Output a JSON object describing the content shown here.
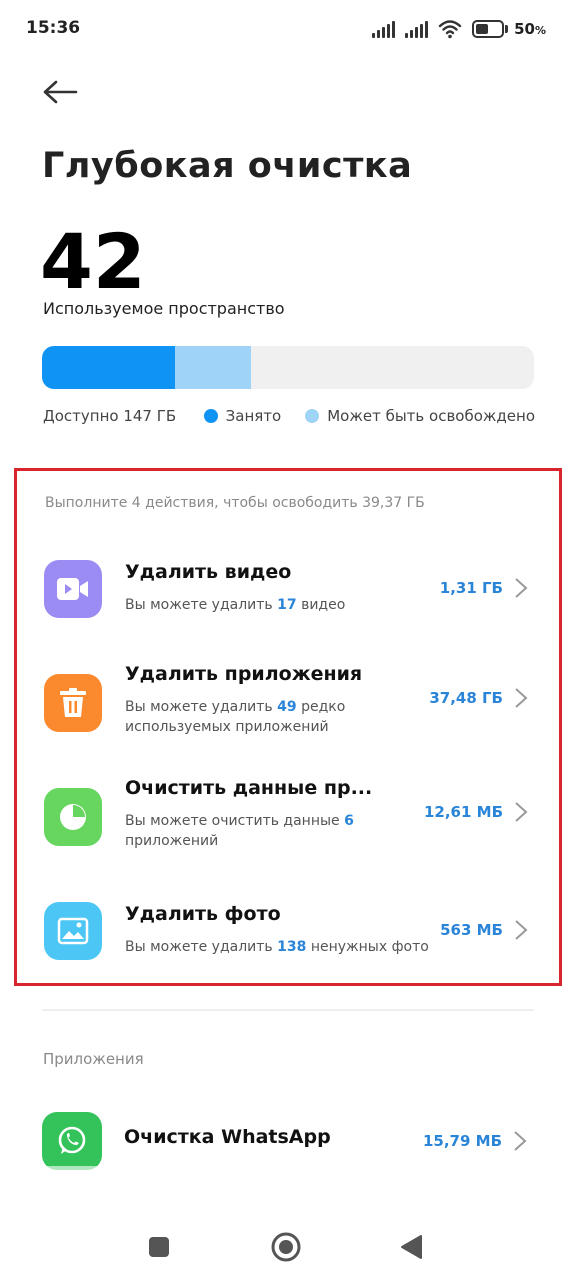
{
  "status_bar": {
    "time": "15:36",
    "battery_percent": "50",
    "battery_suffix": "%",
    "icons": [
      "signal-icon",
      "signal-icon",
      "wifi-icon",
      "battery-icon"
    ]
  },
  "header": {
    "back_icon": "arrow-left-icon",
    "title": "Глубокая очистка"
  },
  "storage": {
    "used_percent": "42",
    "unit": "%",
    "used_label": "Используемое пространство",
    "used_fraction": 0.27,
    "freeable_fraction": 0.155,
    "available_text": "Доступно 147 ГБ",
    "legend_used": "Занято",
    "legend_freeable": "Может быть освобождено",
    "colors": {
      "used": "#0f94f5",
      "freeable": "#9fd3f7",
      "empty": "#f0f0f0"
    }
  },
  "actions": {
    "header": "Выполните 4 действия, чтобы освободить 39,37 ГБ",
    "items": [
      {
        "title": "Удалить видео",
        "sub_before": "Вы можете удалить ",
        "sub_count": "17",
        "sub_after": " видео",
        "size": "1,31 ГБ",
        "icon": "video-icon",
        "color": "#9b8cf4"
      },
      {
        "title": "Удалить приложения",
        "sub_before": "Вы можете удалить ",
        "sub_count": "49",
        "sub_after": " редко используемых приложений",
        "size": "37,48 ГБ",
        "icon": "trash-icon",
        "color": "#fb8a2e"
      },
      {
        "title": "Очистить данные пр...",
        "sub_before": "Вы можете очистить данные ",
        "sub_count": "6",
        "sub_after": " приложений",
        "size": "12,61 МБ",
        "icon": "pie-chart-icon",
        "color": "#67d65e"
      },
      {
        "title": "Удалить фото",
        "sub_before": "Вы можете удалить ",
        "sub_count": "138",
        "sub_after": " ненужных фото",
        "size": "563 МБ",
        "icon": "image-icon",
        "color": "#4cc7f5"
      }
    ]
  },
  "apps": {
    "header": "Приложения",
    "items": [
      {
        "title": "Очистка WhatsApp",
        "size": "15,79 МБ",
        "icon": "whatsapp-icon",
        "color": "#34c25a"
      }
    ]
  },
  "nav_bar": {
    "icons": [
      "recents-square-icon",
      "home-circle-icon",
      "back-triangle-icon"
    ]
  }
}
